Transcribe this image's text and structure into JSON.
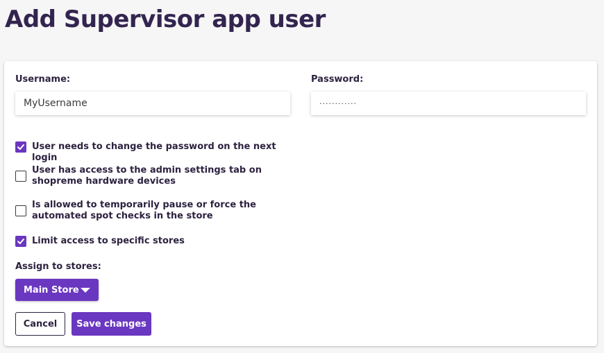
{
  "page": {
    "title": "Add Supervisor app user"
  },
  "form": {
    "username": {
      "label": "Username:",
      "value": "MyUsername"
    },
    "password": {
      "label": "Password:",
      "value": "············"
    },
    "checkboxes": [
      {
        "label": "User needs to change the password on the next login",
        "checked": true
      },
      {
        "label": "User has access to the admin settings tab on shopreme hardware devices",
        "checked": false
      },
      {
        "label": "Is allowed to temporarily pause or force the automated spot checks in the store",
        "checked": false
      },
      {
        "label": "Limit access to specific stores",
        "checked": true
      }
    ],
    "assign_stores": {
      "label": "Assign to stores:",
      "selected": "Main Store"
    }
  },
  "actions": {
    "cancel_label": "Cancel",
    "save_label": "Save changes"
  },
  "colors": {
    "accent": "#6a37c0",
    "title": "#33244f",
    "text": "#2d2240"
  },
  "icons": {
    "check": "checkmark-icon",
    "caret": "caret-down-icon"
  }
}
